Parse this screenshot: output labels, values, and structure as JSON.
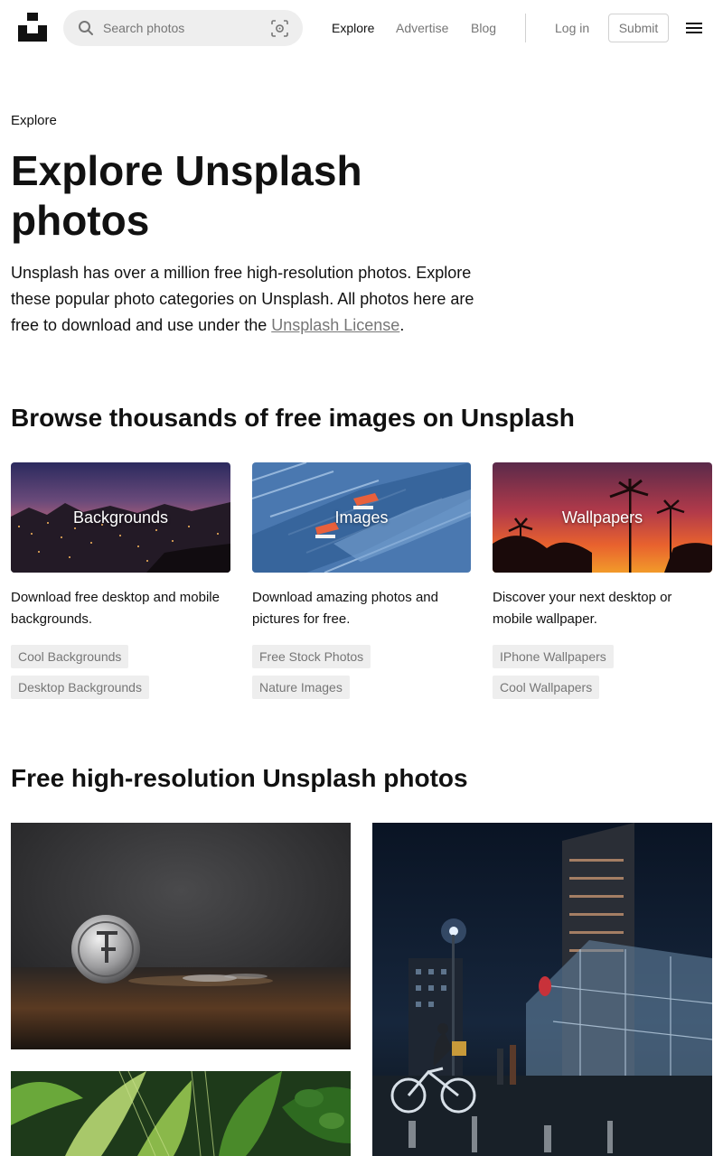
{
  "header": {
    "search_placeholder": "Search photos",
    "nav": [
      {
        "label": "Explore",
        "active": true
      },
      {
        "label": "Advertise",
        "active": false
      },
      {
        "label": "Blog",
        "active": false
      }
    ],
    "login_label": "Log in",
    "submit_label": "Submit"
  },
  "icons": {
    "logo": "unsplash-logo",
    "search": "search-icon",
    "visual_search": "visual-search-icon",
    "menu": "hamburger-menu-icon"
  },
  "breadcrumb": "Explore",
  "page_title": "Explore Unsplash photos",
  "intro": {
    "text": "Unsplash has over a million free high-resolution photos. Explore these popular photo categories on Unsplash. All photos here are free to download and use under the ",
    "link": "Unsplash License",
    "suffix": "."
  },
  "browse_heading": "Browse thousands of free images on Unsplash",
  "categories": [
    {
      "title": "Backgrounds",
      "description": "Download free desktop and mobile backgrounds.",
      "tags": [
        "Cool Backgrounds",
        "Desktop Backgrounds"
      ]
    },
    {
      "title": "Images",
      "description": "Download amazing photos and pictures for free.",
      "tags": [
        "Free Stock Photos",
        "Nature Images"
      ]
    },
    {
      "title": "Wallpapers",
      "description": "Discover your next desktop or mobile wallpaper.",
      "tags": [
        "IPhone Wallpapers",
        "Cool Wallpapers"
      ]
    }
  ],
  "photos_heading": "Free high-resolution Unsplash photos",
  "colors": {
    "text": "#111111",
    "muted": "#767676",
    "chip_bg": "#eeeeee",
    "border": "#d1d1d1"
  }
}
